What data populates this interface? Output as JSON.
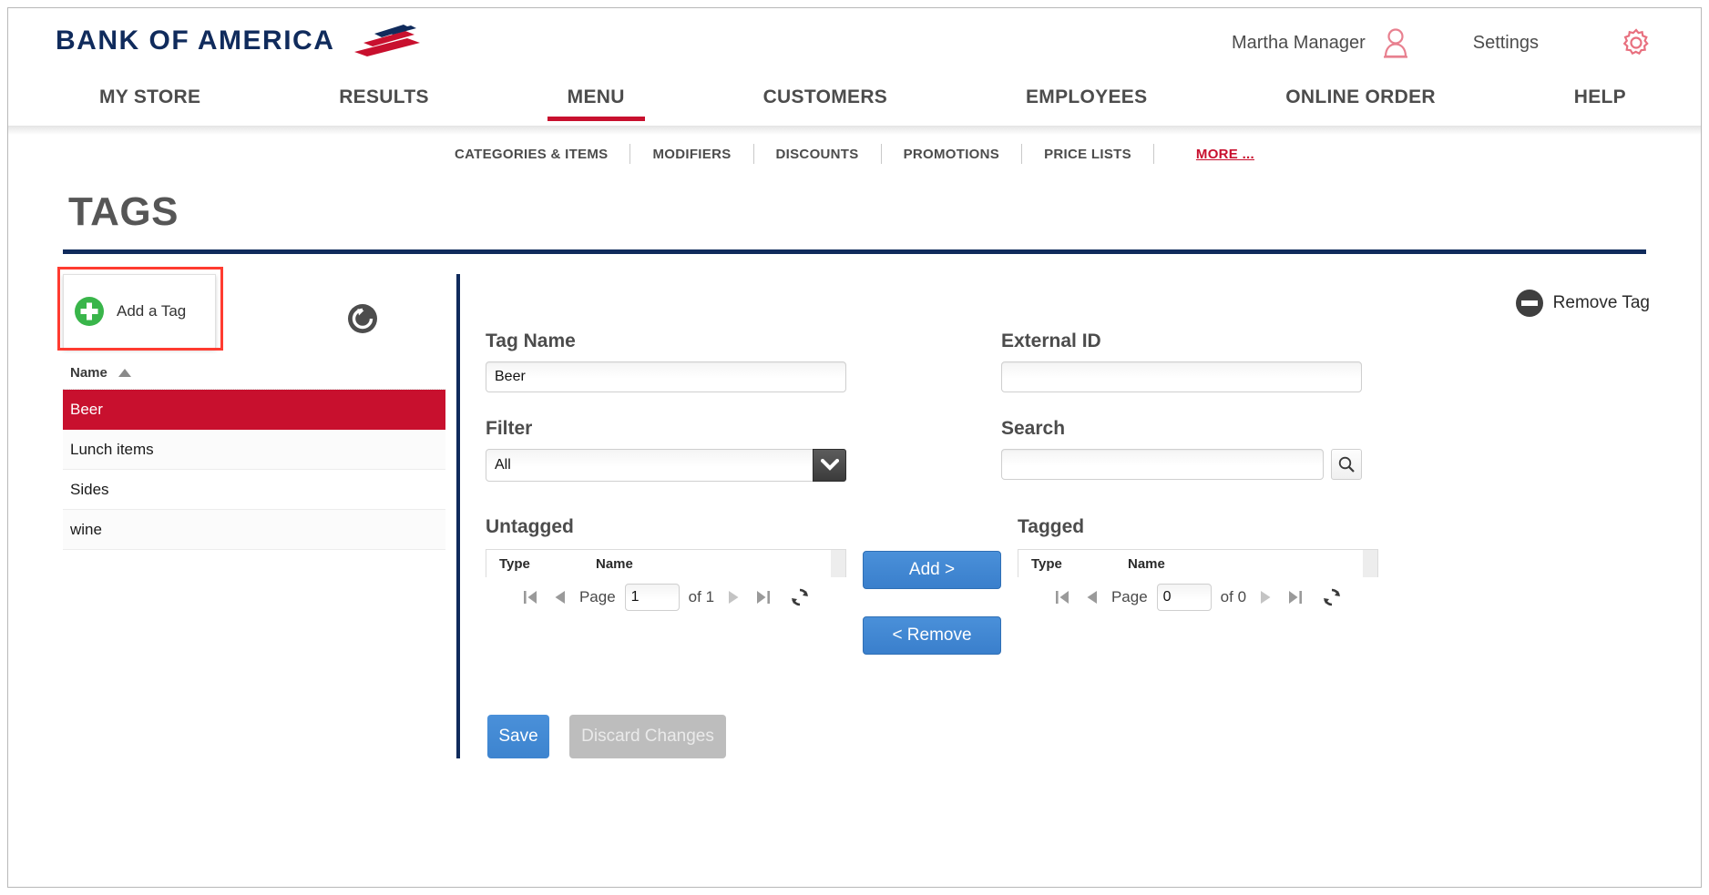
{
  "header": {
    "brand": "BANK OF AMERICA",
    "brand_icon": "bofa-flag-icon",
    "user_name": "Martha Manager",
    "user_icon": "person-icon",
    "settings_label": "Settings",
    "settings_icon": "gear-icon",
    "brand_color": "#102B5C",
    "accent_color": "#c8102e"
  },
  "mainnav": {
    "items": [
      {
        "label": "MY STORE",
        "active": false
      },
      {
        "label": "RESULTS",
        "active": false
      },
      {
        "label": "MENU",
        "active": true
      },
      {
        "label": "CUSTOMERS",
        "active": false
      },
      {
        "label": "EMPLOYEES",
        "active": false
      },
      {
        "label": "ONLINE ORDER",
        "active": false
      },
      {
        "label": "HELP",
        "active": false
      }
    ]
  },
  "subnav": {
    "items": [
      {
        "label": "CATEGORIES & ITEMS"
      },
      {
        "label": "MODIFIERS"
      },
      {
        "label": "DISCOUNTS"
      },
      {
        "label": "PROMOTIONS"
      },
      {
        "label": "PRICE LISTS"
      }
    ],
    "more_label": "MORE ..."
  },
  "page": {
    "title": "TAGS"
  },
  "left": {
    "add_tag_label": "Add a Tag",
    "add_icon": "plus-circle-icon",
    "refresh_icon": "refresh-icon",
    "column_header": "Name",
    "sort_icon": "sort-ascending-icon",
    "rows": [
      {
        "name": "Beer",
        "selected": true
      },
      {
        "name": "Lunch items",
        "selected": false
      },
      {
        "name": "Sides",
        "selected": false
      },
      {
        "name": "wine",
        "selected": false
      }
    ]
  },
  "right": {
    "remove_tag_label": "Remove Tag",
    "remove_icon": "minus-circle-icon",
    "tag_name_label": "Tag Name",
    "tag_name_value": "Beer",
    "external_id_label": "External ID",
    "external_id_value": "",
    "filter_label": "Filter",
    "filter_value": "All",
    "filter_options": [
      "All"
    ],
    "search_label": "Search",
    "search_value": "",
    "search_icon": "magnifier-icon",
    "untagged": {
      "title": "Untagged",
      "columns": [
        "Type",
        "Name"
      ],
      "rows": [],
      "pager": {
        "first_icon": "first-page-icon",
        "prev_icon": "prev-page-icon",
        "page_label": "Page",
        "page_value": "1",
        "of_label": "of 1",
        "next_icon": "next-page-icon",
        "last_icon": "last-page-icon",
        "refresh_icon": "refresh-icon"
      }
    },
    "tagged": {
      "title": "Tagged",
      "columns": [
        "Type",
        "Name"
      ],
      "rows": [],
      "pager": {
        "first_icon": "first-page-icon",
        "prev_icon": "prev-page-icon",
        "page_label": "Page",
        "page_value": "0",
        "of_label": "of 0",
        "next_icon": "next-page-icon",
        "last_icon": "last-page-icon",
        "refresh_icon": "refresh-icon"
      }
    },
    "add_button": "Add >",
    "remove_button": "< Remove",
    "save_button": "Save",
    "discard_button": "Discard Changes"
  }
}
